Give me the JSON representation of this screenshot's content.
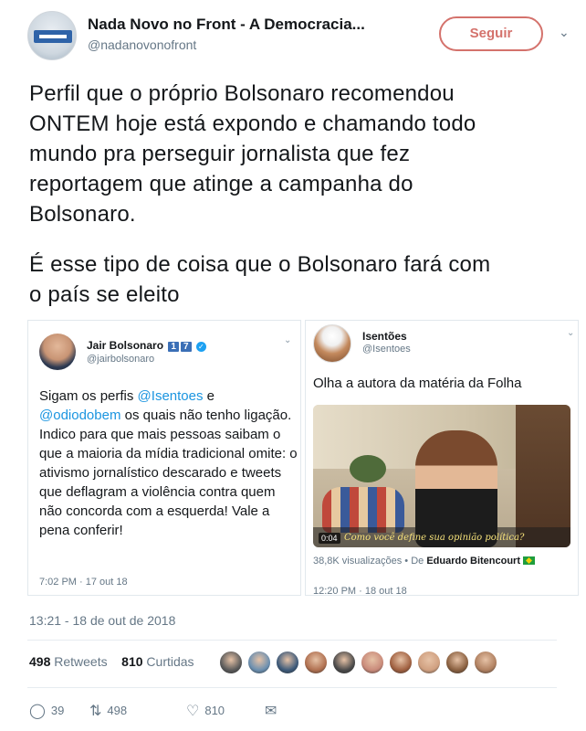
{
  "tweet": {
    "account_name": "Nada Novo no Front - A Democracia...",
    "handle": "@nadanovonofront",
    "follow_label": "Seguir",
    "paragraph1": "Perfil que o próprio Bolsonaro recomendou\nONTEM hoje está expondo e chamando todo\nmundo pra perseguir jornalista que fez\nreportagem que atinge a campanha do\nBolsonaro.",
    "paragraph2": "É esse tipo de coisa que o Bolsonaro fará com\no país se eleito",
    "timestamp": "13:21 - 18 de out de 2018",
    "retweets_count": "498",
    "retweets_label": "Retweets",
    "likes_count": "810",
    "likes_label": "Curtidas",
    "reply_count": "39",
    "retweet_action_count": "498",
    "like_action_count": "810"
  },
  "embed_left": {
    "name": "Jair Bolsonaro",
    "badge1": "1",
    "badge2": "7",
    "handle": "@jairbolsonaro",
    "text_a": "Sigam os perfis ",
    "mention1": "@Isentoes",
    "text_b": " e ",
    "mention2": "@odiodobem",
    "text_c": " os quais não tenho ligação. Indico para que mais pessoas saibam o que a maioria da mídia tradicional omite: o ativismo jornalístico descarado e tweets que deflagram a violência contra quem não concorda com a esquerda! Vale a pena conferir!",
    "time": "7:02 PM · 17 out 18"
  },
  "embed_right": {
    "name": "Isentões",
    "handle": "@Isentoes",
    "text": "Olha a autora da matéria da Folha",
    "video_duration": "0:04",
    "video_caption": "Como você define sua opinião política?",
    "views": "38,8K visualizações",
    "views_sep": " • De ",
    "author": "Eduardo Bitencourt",
    "time": "12:20 PM · 18 out 18"
  },
  "likers": [
    "#5a5a5a",
    "#6b8fb0",
    "#3d5a7a",
    "#b07050",
    "#4a4a4a",
    "#c98a7a",
    "#a06040",
    "#d0a080",
    "#8a6040",
    "#b08060"
  ],
  "icons": {
    "reply": "reply-icon",
    "retweet": "retweet-icon",
    "like": "heart-icon",
    "dm": "envelope-icon",
    "more": "chevron-down-icon"
  }
}
